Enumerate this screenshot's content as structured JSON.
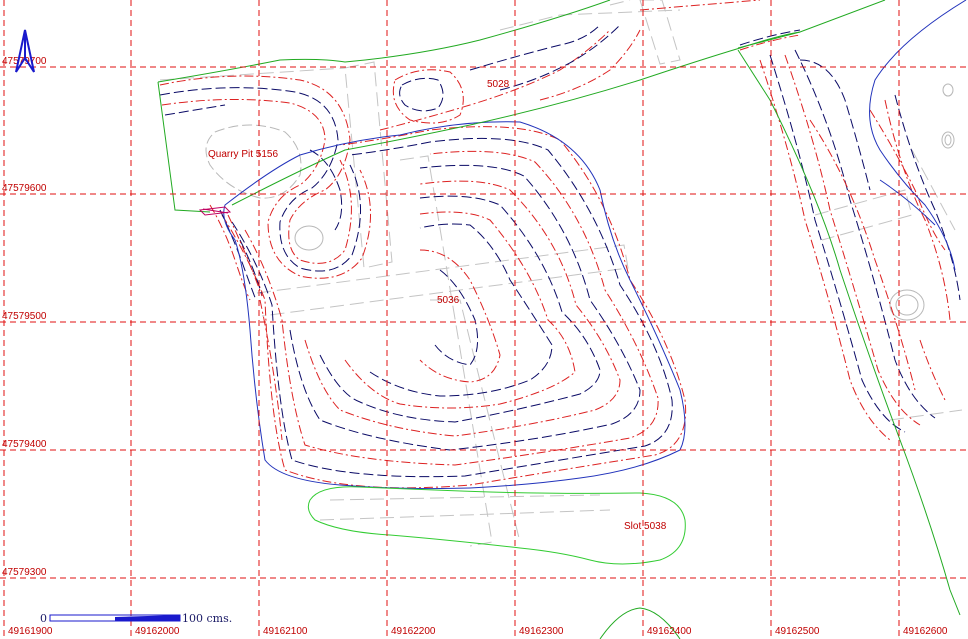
{
  "map": {
    "grid_color": "#e01010",
    "x_labels": [
      "49161900",
      "49162000",
      "49162100",
      "49162200",
      "49162300",
      "49162400",
      "49162500",
      "49162600"
    ],
    "y_labels": [
      "47579700",
      "47579600",
      "47579500",
      "47579400",
      "47579300"
    ],
    "features": {
      "quarry_pit": "Quarry Pit 5156",
      "feature_5028": "5028",
      "feature_5036": "5036",
      "slot": "Slot 5038"
    },
    "scale": {
      "start": "0",
      "end": "100 cms."
    },
    "colors": {
      "boundary": "#22aa22",
      "slot_outline": "#33cc33",
      "cut_outline": "#2233bb",
      "contour_dark": "#0a0a66",
      "contour_red": "#dd2222",
      "sections": "#c8c8c8",
      "north_arrow": "#1a1acc"
    },
    "icons": {
      "north": "north-arrow-icon"
    }
  }
}
